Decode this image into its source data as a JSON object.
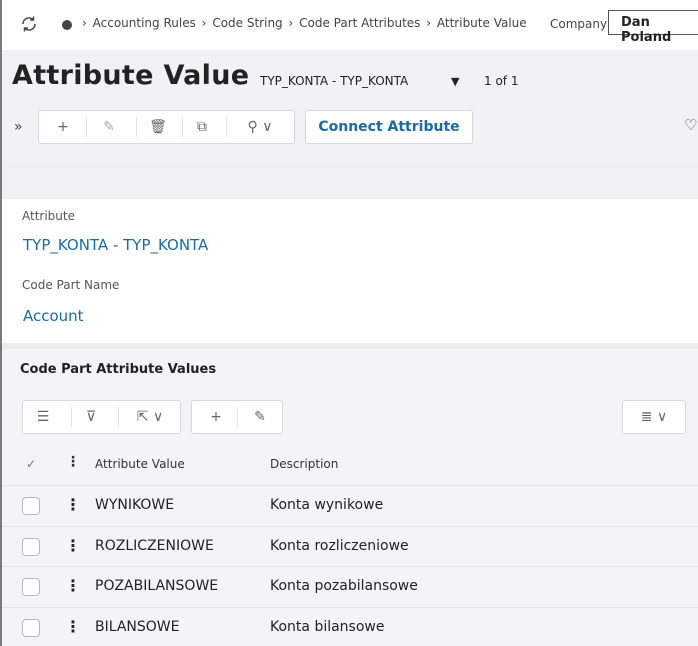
{
  "breadcrumb": [
    "Accounting Rules",
    "Code String",
    "Code Part Attributes",
    "Attribute Value"
  ],
  "company": {
    "label": "Company",
    "value": "Dan Poland"
  },
  "page": {
    "title": "Attribute Value",
    "record": "TYP_KONTA - TYP_KONTA",
    "count": "1 of 1"
  },
  "toolbar": {
    "expand": "»",
    "add": "+",
    "edit": "✎",
    "delete": "🗑",
    "duplicate": "⧉",
    "search": "⚲ ∨",
    "connect_label": "Connect Attribute",
    "favorite": "♡"
  },
  "form": {
    "attribute_label": "Attribute",
    "attribute_value": "TYP_KONTA - TYP_KONTA",
    "code_part_label": "Code Part Name",
    "code_part_value": "Account"
  },
  "grid": {
    "title": "Code Part Attribute Values",
    "columns": {
      "check": "✓",
      "menu": "⋮",
      "attribute_value": "Attribute Value",
      "description": "Description"
    },
    "rows": [
      {
        "value": "WYNIKOWE",
        "description": "Konta wynikowe"
      },
      {
        "value": "ROZLICZENIOWE",
        "description": "Konta rozliczeniowe"
      },
      {
        "value": "POZABILANSOWE",
        "description": "Konta pozabilansowe"
      },
      {
        "value": "BILANSOWE",
        "description": "Konta bilansowe"
      }
    ],
    "tools": {
      "list": "☰",
      "filter": "⊽",
      "export": "⇱ ∨",
      "add": "+",
      "edit": "✎",
      "layout": "≣ ∨"
    }
  },
  "colors": {
    "accent": "#1a6aaa",
    "header_bg": "#f2f2f4"
  }
}
